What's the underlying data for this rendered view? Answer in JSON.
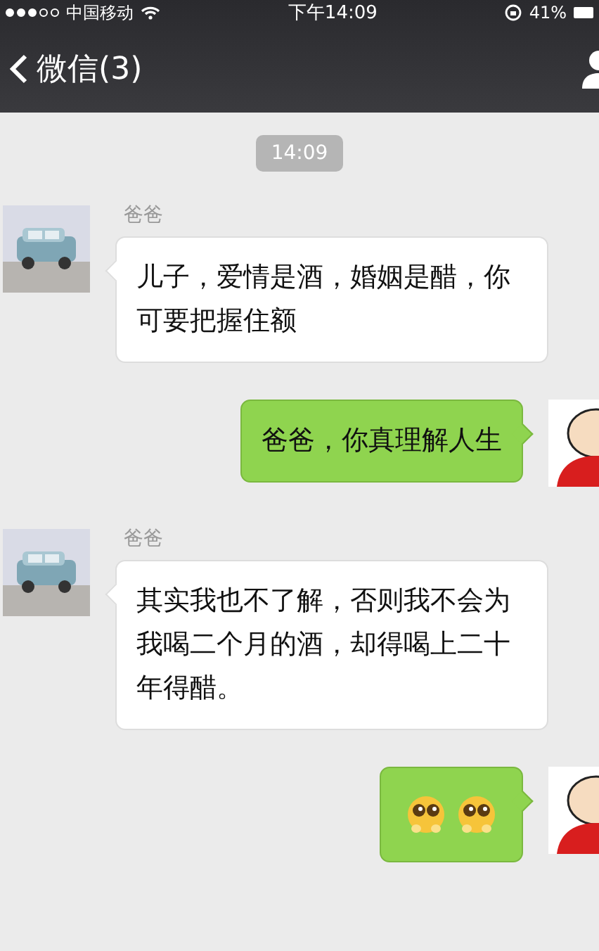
{
  "status_bar": {
    "carrier": "中国移动",
    "time": "下午14:09",
    "battery": "41%"
  },
  "nav_bar": {
    "back": "微信(3)"
  },
  "timestamp": "14:09",
  "messages": [
    {
      "kind": "text",
      "outgoing": false,
      "sender": "爸爸",
      "text": "儿子，爱情是酒，婚姻是醋，你可要把握住额"
    },
    {
      "kind": "text",
      "outgoing": true,
      "text": "爸爸，你真理解人生"
    },
    {
      "kind": "text",
      "outgoing": false,
      "sender": "爸爸",
      "text": "其实我也不了解，否则我不会为我喝二个月的酒，却得喝上二十年得醋。"
    },
    {
      "kind": "emoji",
      "outgoing": true,
      "emojis": [
        {
          "kind": "pleading"
        },
        {
          "kind": "pleading"
        }
      ]
    }
  ]
}
